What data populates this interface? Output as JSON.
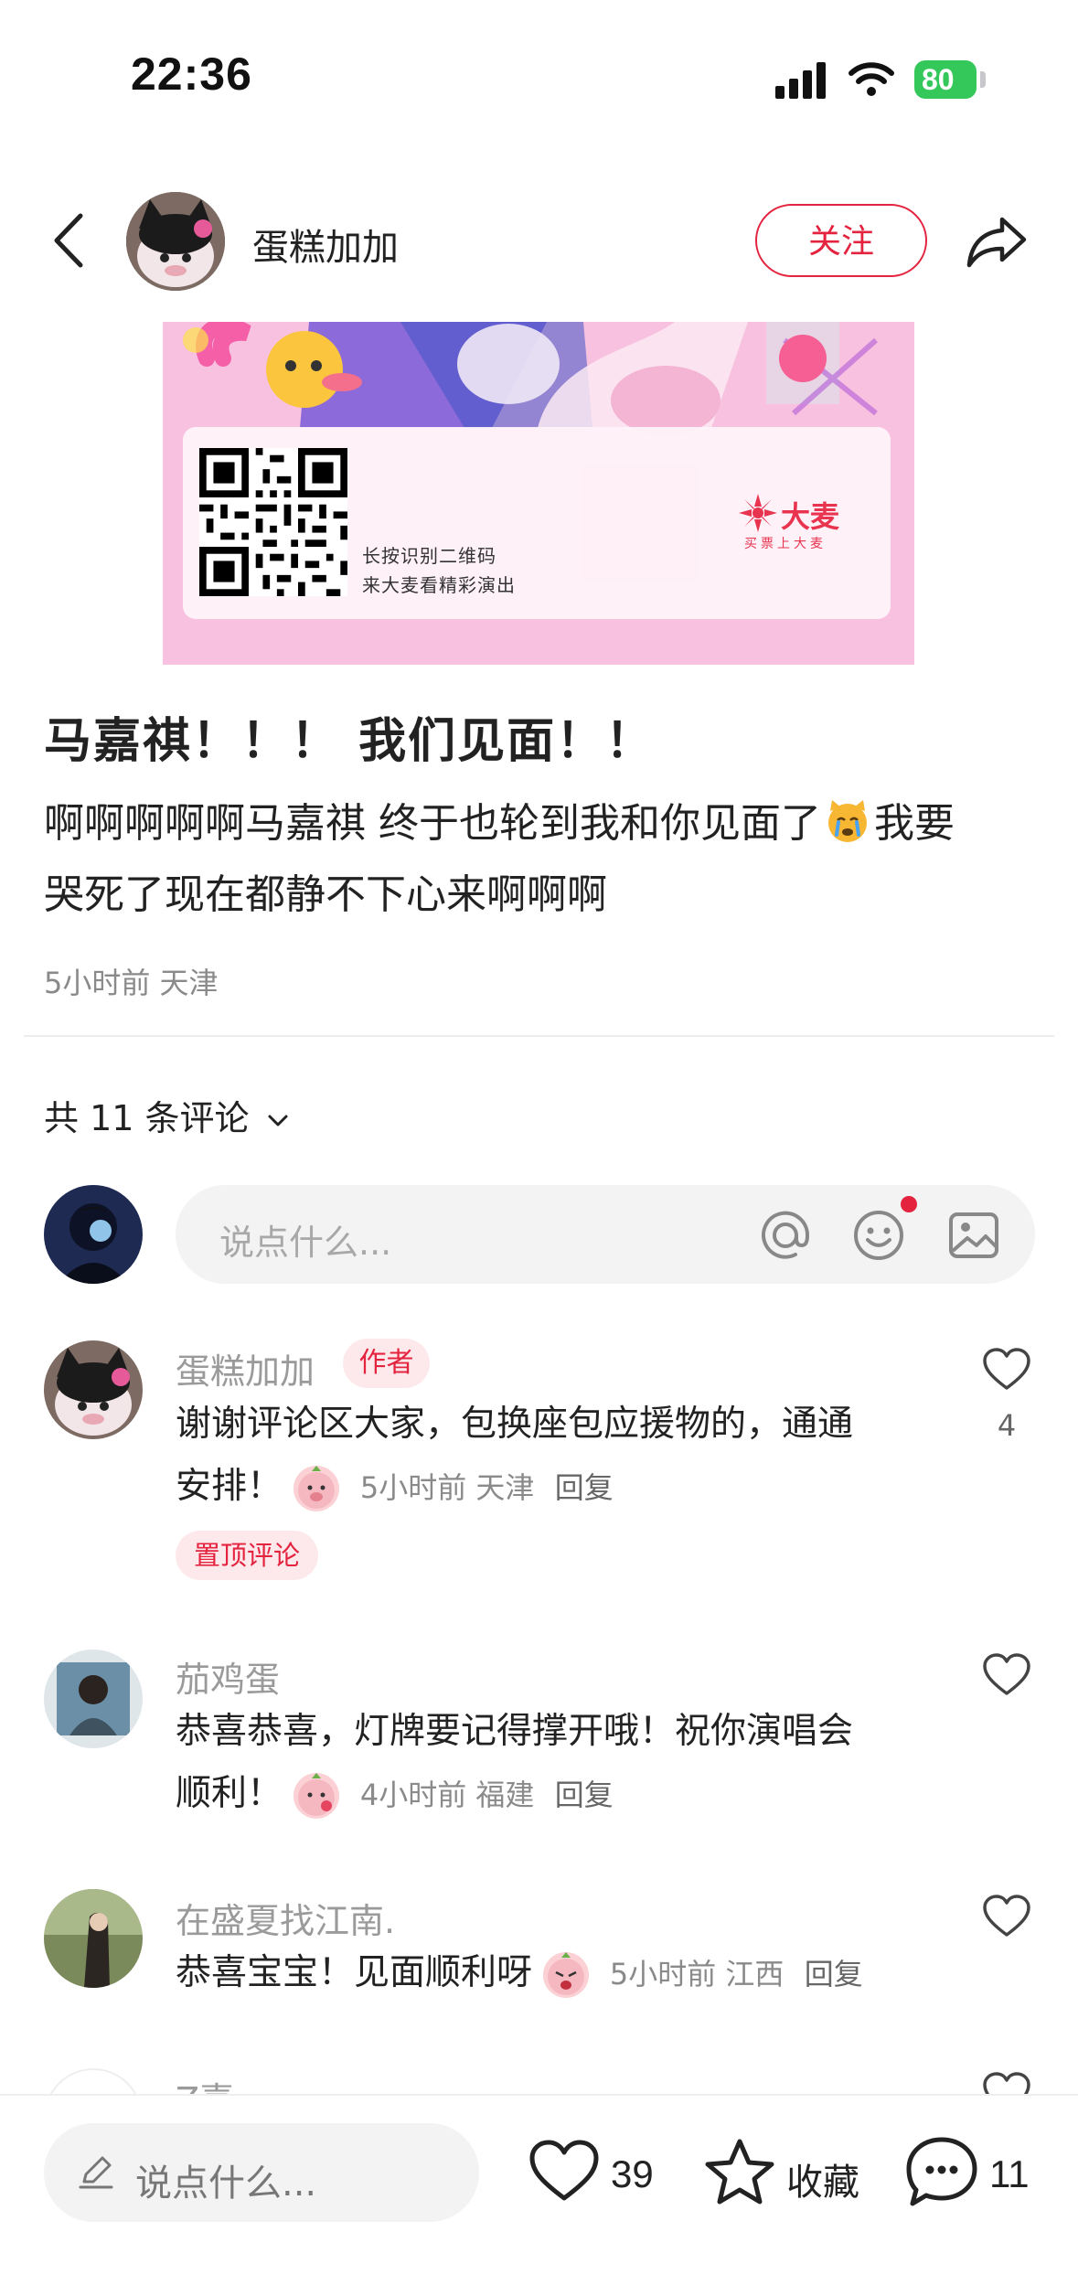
{
  "status_bar": {
    "time": "22:36",
    "battery": "80"
  },
  "header": {
    "author_name": "蛋糕加加",
    "follow_label": "关注"
  },
  "poster": {
    "caption_line1": "长按识别二维码",
    "caption_line2": "来大麦看精彩演出",
    "brand": "大麦",
    "brand_sub": "买票上大麦"
  },
  "post": {
    "title": "马嘉祺！！！ 我们见面！！",
    "body_line1": "啊啊啊啊啊马嘉祺 终于也轮到我和你见面了",
    "body_line1_end": "我要",
    "body_line2": "哭死了现在都静不下心来啊啊啊",
    "meta": "5小时前 天津"
  },
  "comments_header": {
    "label": "共 11 条评论"
  },
  "comment_input": {
    "placeholder": "说点什么..."
  },
  "comments": [
    {
      "name": "蛋糕加加",
      "author_tag": "作者",
      "text_line1": "谢谢评论区大家，包换座包应援物的，通通",
      "text_line2": "安排！",
      "meta": "5小时前 天津",
      "reply": "回复",
      "pinned_tag": "置顶评论",
      "likes": "4"
    },
    {
      "name": "茄鸡蛋",
      "text_line1": "恭喜恭喜，灯牌要记得撑开哦！祝你演唱会",
      "text_line2": "顺利！",
      "meta": "4小时前 福建",
      "reply": "回复"
    },
    {
      "name": "在盛夏找江南.",
      "text_line1": "恭喜宝宝！见面顺利呀",
      "meta": "5小时前 江西",
      "reply": "回复"
    },
    {
      "name": "Z喜"
    }
  ],
  "bottom_bar": {
    "placeholder": "说点什么...",
    "likes": "39",
    "collect_label": "收藏",
    "comments": "11"
  },
  "colors": {
    "accent": "#e4233f",
    "battery": "#34c759"
  }
}
